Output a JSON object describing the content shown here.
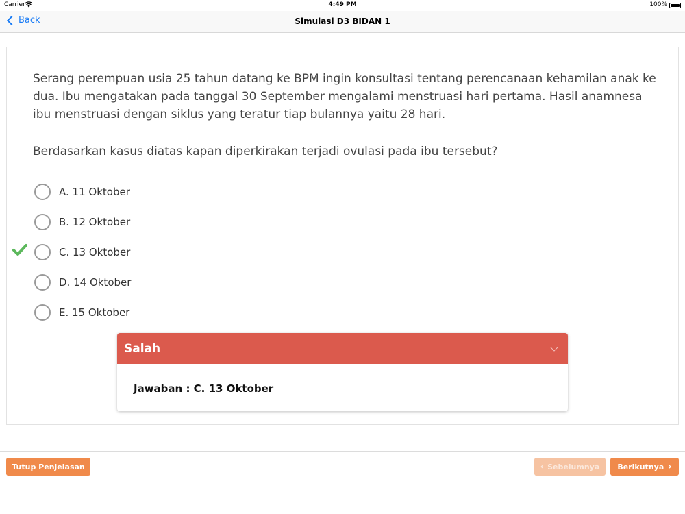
{
  "status_bar": {
    "carrier": "Carrier",
    "time": "4:49 PM",
    "battery": "100%"
  },
  "navbar": {
    "back_label": "Back",
    "title": "Simulasi D3 BIDAN 1"
  },
  "question": {
    "text": "Serang perempuan usia 25 tahun datang ke BPM ingin konsultasi tentang perencanaan kehamilan anak ke dua. Ibu mengatakan pada tanggal 30 September mengalami menstruasi hari pertama. Hasil anamnesa ibu menstruasi dengan siklus yang teratur tiap bulannya yaitu 28 hari.",
    "prompt": "Berdasarkan kasus diatas kapan diperkirakan terjadi ovulasi pada ibu tersebut?",
    "options": [
      {
        "label": "A. 11 Oktober"
      },
      {
        "label": "B. 12 Oktober"
      },
      {
        "label": "C. 13 Oktober",
        "correct": true
      },
      {
        "label": "D. 14 Oktober"
      },
      {
        "label": "E. 15 Oktober"
      }
    ]
  },
  "feedback": {
    "status": "Salah",
    "answer": "Jawaban : C. 13 Oktober",
    "header_color": "#db5a4d"
  },
  "footer": {
    "close_label": "Tutup Penjelasan",
    "prev_label": "Sebelumnya",
    "next_label": "Berikutnya",
    "accent": "#f08a4b"
  },
  "icons": {
    "correct": "checkmark-icon",
    "back": "chevron-left-icon",
    "expand": "chevron-down-icon"
  }
}
